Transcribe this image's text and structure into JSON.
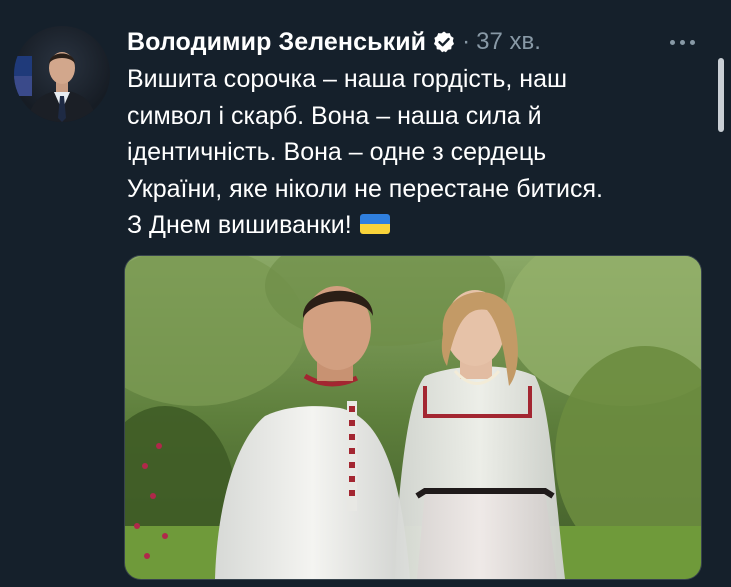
{
  "tweet": {
    "author_name": "Володимир Зеленський",
    "separator": "·",
    "timestamp": "37 хв.",
    "text_lines": [
      "Вишита сорочка – наша гордість, наш",
      "символ і скарб. Вона – наша сила й",
      "ідентичність. Вона – одне з сердець",
      "України, яке ніколи не перестане битися.",
      "З Днем вишиванки!"
    ],
    "flag_emoji": "ukraine-flag",
    "verified_icon": "verified-badge",
    "more_icon": "more-horizontal"
  },
  "colors": {
    "background": "#15202b",
    "text": "#ffffff",
    "secondary_text": "#8899a6",
    "flag_blue": "#2f7fde",
    "flag_yellow": "#f8d33a"
  }
}
